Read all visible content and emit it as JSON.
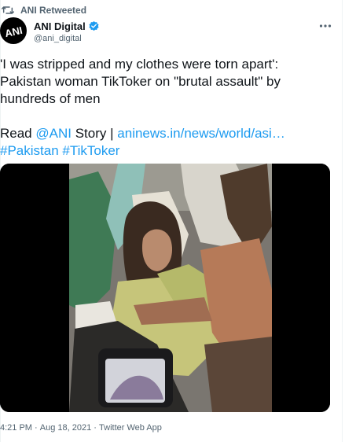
{
  "retweet": {
    "icon": "retweet-icon",
    "label": "ANI Retweeted"
  },
  "author": {
    "avatar": "ani-logo-avatar",
    "avatar_text": "ANI",
    "name": "ANI Digital",
    "verified_icon": "verified-badge-icon",
    "handle": "@ani_digital"
  },
  "more_icon": "more-icon",
  "tweet": {
    "lines": [
      "'I was stripped and my clothes were torn apart':",
      "Pakistan woman TikToker on \"brutal assault\" by",
      "hundreds of men"
    ],
    "read_prefix": "Read",
    "mention": "@ANI",
    "story_word": "Story |",
    "url": "aninews.in/news/world/asi…",
    "hashtags": [
      "#Pakistan",
      "#TikToker"
    ]
  },
  "media": {
    "description_icon": "video-still-image"
  },
  "meta": {
    "time": "4:21 PM",
    "separator": "·",
    "date": "Aug 18, 2021",
    "source": "Twitter Web App"
  },
  "colors": {
    "text": "#0f1419",
    "secondary": "#536471",
    "link": "#1d9bf0",
    "verified": "#1d9bf0"
  }
}
